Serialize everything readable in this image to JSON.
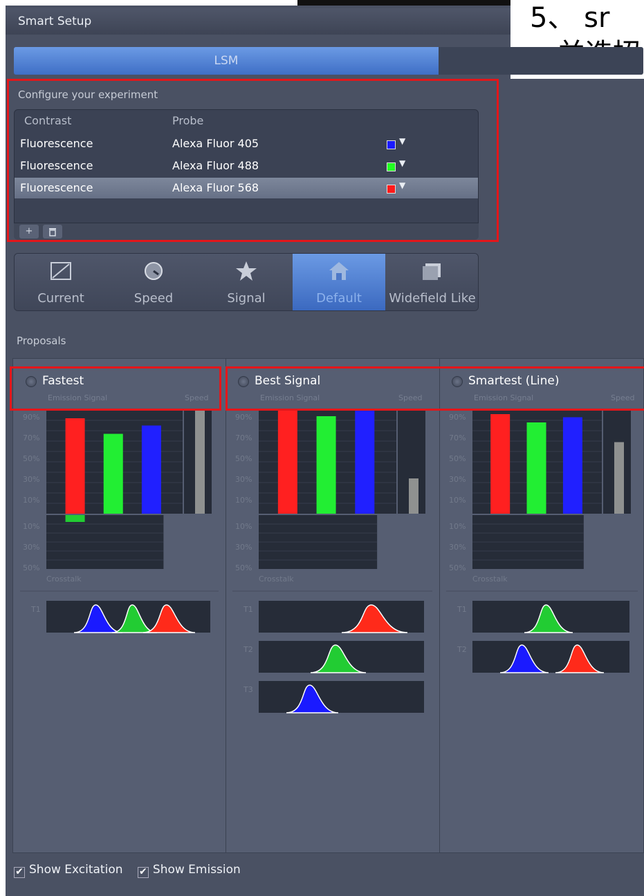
{
  "window": {
    "title": "Smart Setup"
  },
  "overlay_text": {
    "line1": "5、    sr",
    "line2": "，并选招"
  },
  "tabs": {
    "active": "LSM"
  },
  "configure": {
    "label": "Configure your experiment",
    "columns": [
      "Contrast",
      "Probe"
    ],
    "rows": [
      {
        "contrast": "Fluorescence",
        "probe": "Alexa Fluor 405",
        "color": "#1a1aff",
        "selected": false
      },
      {
        "contrast": "Fluorescence",
        "probe": "Alexa Fluor 488",
        "color": "#22ff22",
        "selected": false
      },
      {
        "contrast": "Fluorescence",
        "probe": "Alexa Fluor 568",
        "color": "#ff1a1a",
        "selected": true
      }
    ],
    "add_label": "+",
    "delete_icon": "trash-icon"
  },
  "modes": [
    {
      "label": "Current",
      "icon": "current-icon",
      "active": false
    },
    {
      "label": "Speed",
      "icon": "speedometer-icon",
      "active": false
    },
    {
      "label": "Signal",
      "icon": "star-icon",
      "active": false
    },
    {
      "label": "Default",
      "icon": "home-icon",
      "active": true
    },
    {
      "label": "Widefield Like",
      "icon": "widefield-icon",
      "active": false
    }
  ],
  "proposals": {
    "label": "Proposals",
    "emission_label": "Emission Signal",
    "speed_label": "Speed",
    "crosstalk_label": "Crosstalk",
    "signal_ticks": [
      "90%",
      "70%",
      "50%",
      "30%",
      "10%"
    ],
    "crosstalk_ticks": [
      "10%",
      "30%",
      "50%"
    ],
    "items": [
      {
        "title": "Fastest",
        "signal": {
          "red": 0.92,
          "green": 0.77,
          "blue": 0.85
        },
        "speed": 1.0,
        "crosstalk_green": 0.08,
        "tracks": [
          "T1"
        ]
      },
      {
        "title": "Best Signal",
        "signal": {
          "red": 1.0,
          "green": 0.94,
          "blue": 1.0
        },
        "speed": 0.34,
        "crosstalk_green": 0,
        "tracks": [
          "T1",
          "T2",
          "T3"
        ]
      },
      {
        "title": "Smartest (Line)",
        "signal": {
          "red": 0.96,
          "green": 0.88,
          "blue": 0.93
        },
        "speed": 0.69,
        "crosstalk_green": 0,
        "tracks": [
          "T1",
          "T2"
        ]
      }
    ]
  },
  "footer": {
    "show_excitation": "Show Excitation",
    "show_emission": "Show Emission",
    "check_mark": "✔"
  }
}
